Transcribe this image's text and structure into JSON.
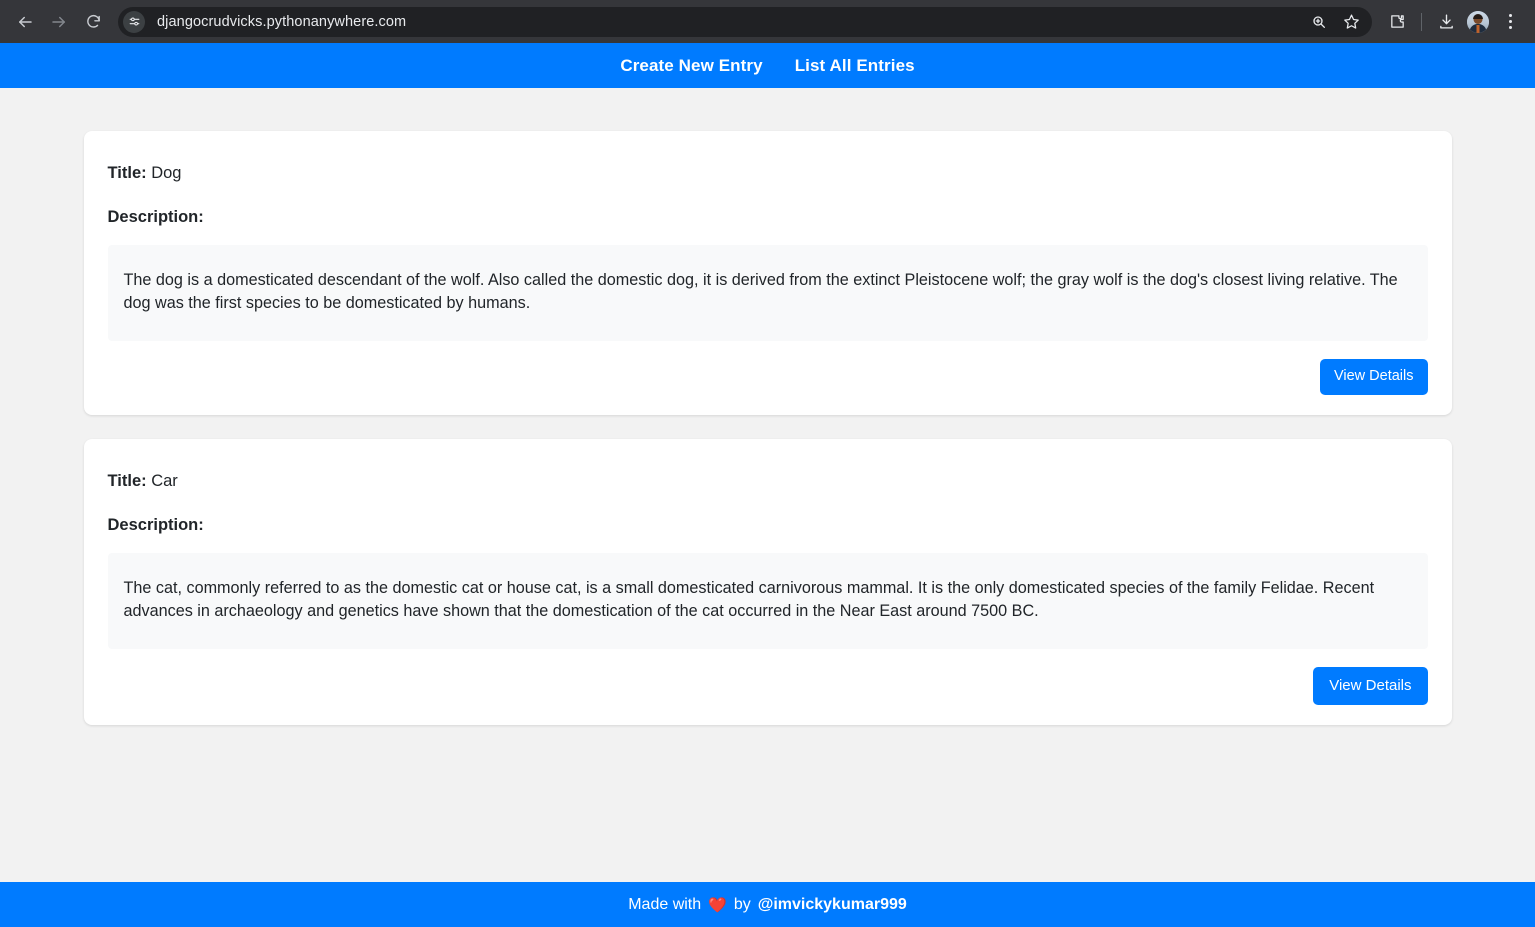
{
  "browser": {
    "back_icon": "back-arrow-icon",
    "forward_icon": "forward-arrow-icon",
    "reload_icon": "reload-icon",
    "site_settings_icon": "tune-sliders-icon",
    "url": "djangocrudvicks.pythonanywhere.com",
    "zoom_icon": "zoom-magnifier-icon",
    "bookmark_icon": "bookmark-star-icon",
    "extensions_icon": "extensions-puzzle-icon",
    "downloads_icon": "downloads-icon",
    "profile_icon": "profile-avatar-icon",
    "menu_icon": "three-dot-menu-icon"
  },
  "navbar": {
    "background": "#007bff",
    "links": [
      {
        "label": "Create New Entry"
      },
      {
        "label": "List All Entries"
      }
    ]
  },
  "main": {
    "title_label": "Title:",
    "description_label": "Description:",
    "entries": [
      {
        "title": "Dog",
        "description": "The dog is a domesticated descendant of the wolf. Also called the domestic dog, it is derived from the extinct Pleistocene wolf; the gray wolf is the dog's closest living relative. The dog was the first species to be domesticated by humans.",
        "button_label": "View Details"
      },
      {
        "title": "Car",
        "description": "The cat, commonly referred to as the domestic cat or house cat, is a small domesticated carnivorous mammal. It is the only domesticated species of the family Felidae. Recent advances in archaeology and genetics have shown that the domestication of the cat occurred in the Near East around 7500 BC.",
        "button_label": "View Details"
      }
    ]
  },
  "footer": {
    "made_with": "Made with",
    "heart": "❤️",
    "by": "by",
    "handle": "@imvickykumar999",
    "background": "#007bff"
  }
}
